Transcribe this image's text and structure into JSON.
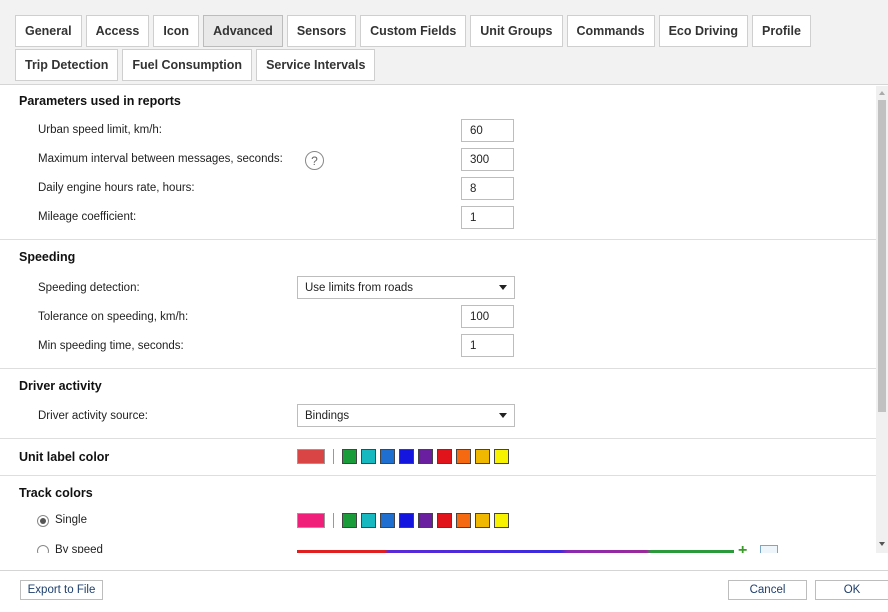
{
  "tabs": {
    "row1": [
      "General",
      "Access",
      "Icon",
      "Advanced",
      "Sensors",
      "Custom Fields",
      "Unit Groups",
      "Commands",
      "Eco Driving",
      "Profile"
    ],
    "row2": [
      "Trip Detection",
      "Fuel Consumption",
      "Service Intervals"
    ],
    "active": "Advanced"
  },
  "parameters": {
    "title": "Parameters used in reports",
    "urban_speed_label": "Urban speed limit, km/h:",
    "urban_speed_value": "60",
    "max_interval_label": "Maximum interval between messages, seconds:",
    "help_icon_glyph": "?",
    "max_interval_value": "300",
    "engine_hours_label": "Daily engine hours rate, hours:",
    "engine_hours_value": "8",
    "mileage_label": "Mileage coefficient:",
    "mileage_value": "1"
  },
  "speeding": {
    "title": "Speeding",
    "detection_label": "Speeding detection:",
    "detection_value": "Use limits from roads",
    "tolerance_label": "Tolerance on speeding, km/h:",
    "tolerance_value": "100",
    "min_time_label": "Min speeding time, seconds:",
    "min_time_value": "1"
  },
  "driver_activity": {
    "title": "Driver activity",
    "source_label": "Driver activity source:",
    "source_value": "Bindings"
  },
  "unit_label_color": {
    "title": "Unit label color",
    "current": "#d94545",
    "swatches": [
      "#1a9c3a",
      "#18b8c0",
      "#1f6fd0",
      "#1515e0",
      "#6a1fa0",
      "#e0141a",
      "#f56a10",
      "#f0b800",
      "#f7f300"
    ]
  },
  "track_colors": {
    "title": "Track colors",
    "single_label": "Single",
    "single_checked": true,
    "single_current": "#f0207a",
    "swatches": [
      "#1a9c3a",
      "#18b8c0",
      "#1f6fd0",
      "#1515e0",
      "#6a1fa0",
      "#e0141a",
      "#f56a10",
      "#f0b800",
      "#f7f300"
    ],
    "by_speed_label": "By speed",
    "by_speed_checked": false
  },
  "footer": {
    "export_label": "Export to File",
    "cancel_label": "Cancel",
    "ok_label": "OK"
  }
}
